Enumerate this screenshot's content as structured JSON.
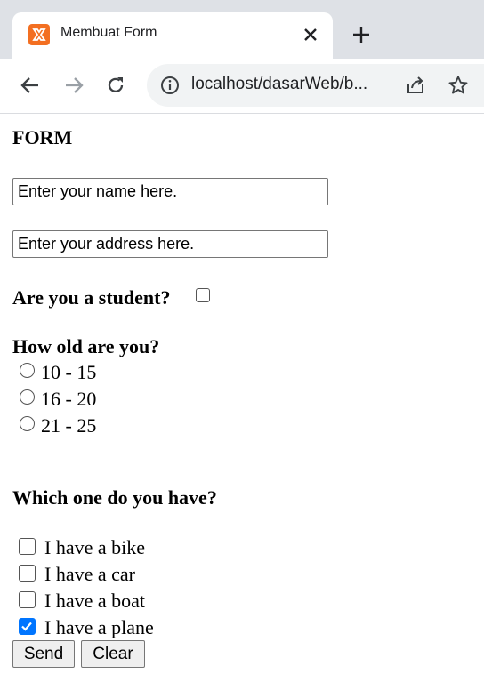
{
  "browser": {
    "tab_title": "Membuat Form",
    "url": "localhost/dasarWeb/b..."
  },
  "form": {
    "heading": "FORM",
    "name_placeholder": "Enter your name here.",
    "address_placeholder": "Enter your address here.",
    "student_question": "Are you a student?",
    "student_checked": false,
    "age_question": "How old are you?",
    "age_options": [
      "10 - 15",
      "16 - 20",
      "21 - 25"
    ],
    "vehicle_question": "Which one do you have?",
    "vehicle_options": [
      {
        "label": "I have a bike",
        "checked": false
      },
      {
        "label": "I have a car",
        "checked": false
      },
      {
        "label": "I have a boat",
        "checked": false
      },
      {
        "label": "I have a plane",
        "checked": true
      }
    ],
    "send_label": "Send",
    "clear_label": "Clear"
  },
  "icons": {
    "favicon": "xampp-logo-icon",
    "close": "close-icon",
    "new_tab": "plus-icon",
    "back": "back-arrow-icon",
    "forward": "forward-arrow-icon",
    "reload": "reload-icon",
    "site_info": "info-icon",
    "share": "share-icon",
    "bookmark": "star-icon"
  },
  "colors": {
    "favicon": "#f36f21",
    "checkbox_checked": "#0075ff"
  }
}
